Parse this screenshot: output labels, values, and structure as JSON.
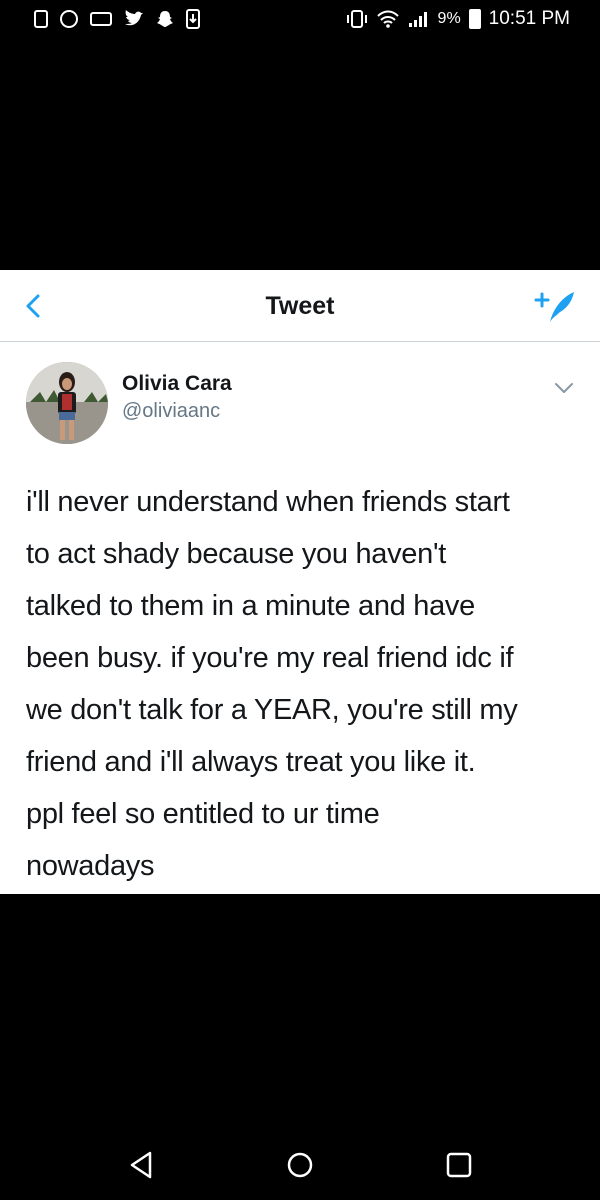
{
  "status_bar": {
    "battery_percent": "9%",
    "time": "10:51 PM",
    "left_icons": [
      "notification-icon",
      "instagram-icon",
      "voicemail-icon",
      "twitter-icon",
      "snapchat-icon",
      "download-icon"
    ],
    "right_icons": [
      "vibrate-icon",
      "wifi-icon",
      "signal-icon",
      "battery-icon"
    ]
  },
  "topbar": {
    "title": "Tweet",
    "back_icon": "chevron-left-icon",
    "compose_icon": "compose-tweet-icon"
  },
  "tweet": {
    "author_name": "Olivia Cara",
    "author_handle": "@oliviaanc",
    "text_lines": [
      "i'll never understand when friends start",
      "to act shady because you haven't",
      "talked to them in a minute and have",
      "been busy. if you're my real friend idc if",
      "we don't talk for a YEAR, you're still my",
      "friend and i'll always treat you like it.",
      "ppl feel so entitled to ur time",
      "nowadays"
    ]
  },
  "colors": {
    "accent": "#1da1f2",
    "text": "#14171a",
    "muted": "#657786",
    "background": "#000000",
    "card": "#ffffff"
  },
  "navbar": {
    "icons": [
      "back-triangle-icon",
      "home-circle-icon",
      "recents-square-icon"
    ]
  }
}
